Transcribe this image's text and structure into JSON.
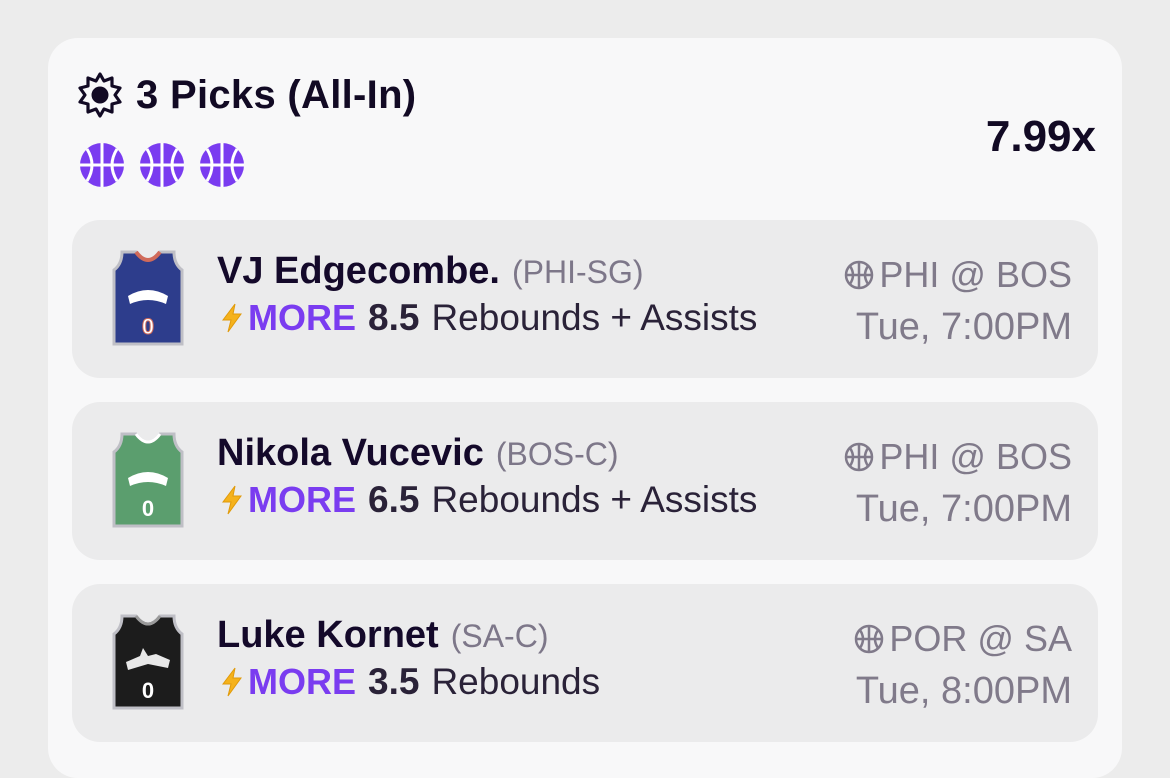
{
  "header": {
    "title": "3 Picks (All-In)",
    "multiplier": "7.99x",
    "icon": "sun-burst-icon",
    "sport_icon": "basketball-icon",
    "accent": "#7a3cf0"
  },
  "picks": [
    {
      "name": "VJ Edgecombe.",
      "team_pos": "(PHI-SG)",
      "direction": "MORE",
      "line": "8.5",
      "stat": "Rebounds + Assists",
      "matchup": "PHI @ BOS",
      "time": "Tue, 7:00PM",
      "jersey_number": "0",
      "jersey_color": "#2d3d8c"
    },
    {
      "name": "Nikola Vucevic",
      "team_pos": "(BOS-C)",
      "direction": "MORE",
      "line": "6.5",
      "stat": "Rebounds + Assists",
      "matchup": "PHI @ BOS",
      "time": "Tue, 7:00PM",
      "jersey_number": "0",
      "jersey_color": "#5b9e6e"
    },
    {
      "name": "Luke Kornet",
      "team_pos": "(SA-C)",
      "direction": "MORE",
      "line": "3.5",
      "stat": "Rebounds",
      "matchup": "POR @ SA",
      "time": "Tue, 8:00PM",
      "jersey_number": "0",
      "jersey_color": "#1c1c1c"
    }
  ]
}
